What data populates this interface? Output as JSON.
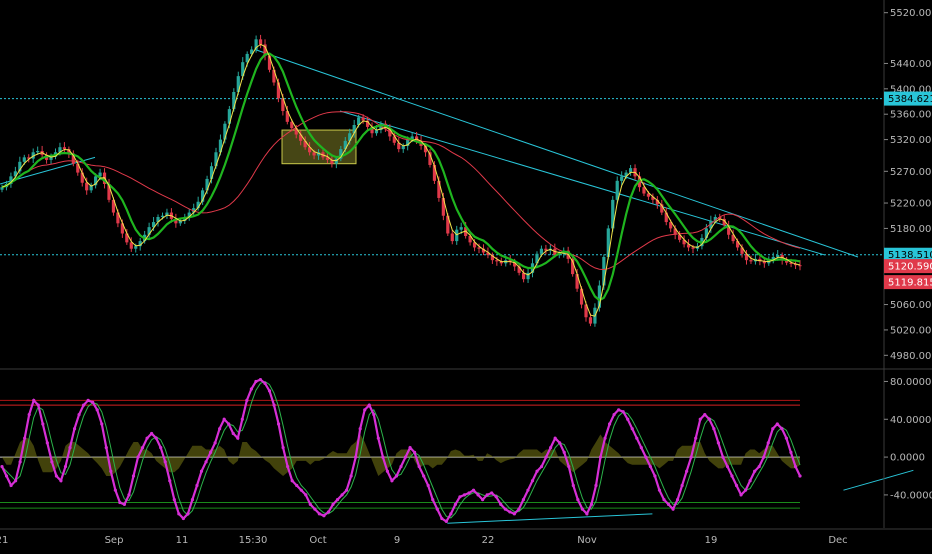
{
  "chart_data": [
    {
      "type": "candlestick",
      "pane": "price",
      "ylim": [
        4960,
        5540
      ],
      "y_ticks": [
        "5520.000",
        "5440.000",
        "5400.000",
        "5360.000",
        "5320.000",
        "5270.000",
        "5220.000",
        "5180.000",
        "5140.000",
        "5060.000",
        "5020.000",
        "4980.000"
      ],
      "y_tick_values": [
        5520,
        5440,
        5400,
        5360,
        5320,
        5270,
        5220,
        5180,
        5140,
        5060,
        5020,
        4980
      ],
      "x_labels": [
        "21",
        "Sep",
        "11",
        "15:30",
        "Oct",
        "9",
        "22",
        "Nov",
        "19",
        "Dec"
      ],
      "grid": false,
      "close_series": [
        5245,
        5250,
        5262,
        5270,
        5285,
        5292,
        5290,
        5300,
        5302,
        5296,
        5288,
        5293,
        5300,
        5308,
        5305,
        5298,
        5282,
        5268,
        5252,
        5240,
        5248,
        5262,
        5268,
        5250,
        5225,
        5205,
        5188,
        5172,
        5158,
        5148,
        5152,
        5160,
        5170,
        5182,
        5190,
        5198,
        5200,
        5205,
        5195,
        5188,
        5192,
        5198,
        5205,
        5212,
        5222,
        5240,
        5258,
        5278,
        5300,
        5320,
        5345,
        5368,
        5395,
        5420,
        5442,
        5455,
        5462,
        5478,
        5470,
        5452,
        5430,
        5410,
        5385,
        5365,
        5348,
        5338,
        5328,
        5318,
        5308,
        5300,
        5295,
        5300,
        5292,
        5288,
        5282,
        5290,
        5305,
        5318,
        5330,
        5343,
        5355,
        5350,
        5340,
        5330,
        5335,
        5345,
        5338,
        5325,
        5315,
        5305,
        5310,
        5320,
        5325,
        5318,
        5310,
        5300,
        5280,
        5255,
        5228,
        5200,
        5172,
        5160,
        5178,
        5182,
        5168,
        5158,
        5150,
        5148,
        5142,
        5138,
        5130,
        5128,
        5125,
        5130,
        5128,
        5120,
        5110,
        5100,
        5110,
        5125,
        5140,
        5148,
        5145,
        5148,
        5138,
        5140,
        5145,
        5132,
        5108,
        5085,
        5060,
        5040,
        5030,
        5055,
        5090,
        5135,
        5180,
        5225,
        5255,
        5262,
        5268,
        5275,
        5262,
        5245,
        5235,
        5230,
        5225,
        5218,
        5205,
        5190,
        5180,
        5170,
        5162,
        5155,
        5150,
        5148,
        5152,
        5165,
        5180,
        5192,
        5198,
        5195,
        5185,
        5170,
        5160,
        5150,
        5140,
        5130,
        5128,
        5132,
        5128,
        5125,
        5130,
        5135,
        5138,
        5130,
        5126,
        5124,
        5122,
        5121
      ],
      "levels": [
        {
          "label": "5384.621",
          "value": 5384.621,
          "color": "#29c5d8"
        },
        {
          "label": "5138.510",
          "value": 5138.51,
          "color": "#29c5d8"
        }
      ],
      "price_labels": [
        {
          "label": "5120.590",
          "value": 5120.59,
          "color": "#e0394a"
        },
        {
          "label": "5119.815",
          "value": 5119.815,
          "color": "#e0394a"
        }
      ]
    },
    {
      "type": "line",
      "pane": "oscillator",
      "ylim": [
        -75,
        90
      ],
      "y_ticks": [
        "80.0000",
        "40.0000",
        "0.0000",
        "-40.0000"
      ],
      "y_tick_values": [
        80,
        40,
        0,
        -40
      ],
      "levels": [
        {
          "value": 60,
          "color": "#b01515"
        },
        {
          "value": 55,
          "color": "#d32020"
        },
        {
          "value": 0,
          "color": "#c8c8c8"
        },
        {
          "value": -48,
          "color": "#1a8a1a"
        },
        {
          "value": -54,
          "color": "#1a8a1a"
        }
      ],
      "series": [
        {
          "color": "#d62fd6",
          "values": [
            -10,
            -20,
            -30,
            -25,
            -5,
            20,
            45,
            60,
            55,
            35,
            15,
            -5,
            -20,
            -25,
            -10,
            10,
            30,
            45,
            55,
            60,
            58,
            50,
            35,
            10,
            -15,
            -35,
            -48,
            -50,
            -40,
            -20,
            0,
            10,
            20,
            25,
            20,
            10,
            -5,
            -25,
            -45,
            -60,
            -65,
            -60,
            -45,
            -30,
            -15,
            -5,
            5,
            15,
            30,
            40,
            35,
            25,
            20,
            40,
            60,
            72,
            80,
            82,
            78,
            70,
            55,
            35,
            10,
            -10,
            -25,
            -30,
            -35,
            -40,
            -50,
            -55,
            -60,
            -62,
            -58,
            -50,
            -45,
            -40,
            -35,
            -20,
            0,
            30,
            50,
            55,
            45,
            20,
            0,
            -15,
            -25,
            -20,
            -10,
            0,
            10,
            5,
            -10,
            -20,
            -30,
            -45,
            -55,
            -65,
            -68,
            -60,
            -50,
            -42,
            -40,
            -38,
            -35,
            -40,
            -45,
            -40,
            -38,
            -42,
            -50,
            -55,
            -58,
            -60,
            -55,
            -45,
            -35,
            -25,
            -15,
            -10,
            0,
            10,
            20,
            15,
            5,
            -10,
            -30,
            -45,
            -55,
            -60,
            -50,
            -30,
            0,
            20,
            35,
            45,
            50,
            48,
            40,
            30,
            20,
            10,
            0,
            -10,
            -20,
            -35,
            -45,
            -50,
            -55,
            -45,
            -30,
            -15,
            0,
            20,
            40,
            45,
            40,
            30,
            15,
            0,
            -10,
            -20,
            -30,
            -40,
            -35,
            -25,
            -15,
            -10,
            0,
            15,
            30,
            35,
            30,
            20,
            5,
            -10,
            -20
          ]
        }
      ],
      "trendlines": [
        {
          "from": [
            0.905,
            -35
          ],
          "to": [
            0.98,
            -14
          ]
        },
        {
          "from": [
            0.48,
            -70
          ],
          "to": [
            0.7,
            -60
          ]
        }
      ]
    }
  ]
}
